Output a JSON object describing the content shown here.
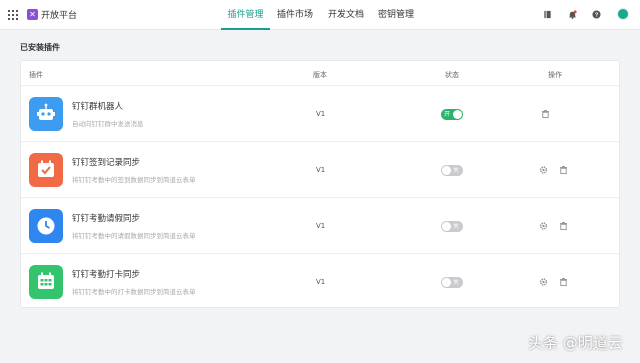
{
  "header": {
    "title": "开放平台",
    "nav": [
      {
        "label": "插件管理",
        "active": true
      },
      {
        "label": "插件市场",
        "active": false
      },
      {
        "label": "开发文档",
        "active": false
      },
      {
        "label": "密钥管理",
        "active": false
      }
    ],
    "icons": [
      "book-icon",
      "bell-icon",
      "help-icon",
      "avatar"
    ]
  },
  "section": {
    "title": "已安装插件"
  },
  "table": {
    "columns": {
      "plugin": "插件",
      "version": "版本",
      "status": "状态",
      "action": "操作"
    },
    "rows": [
      {
        "name": "钉钉群机器人",
        "desc": "自动向钉钉群中发送消息",
        "version": "V1",
        "status": "开",
        "enabled": true,
        "icon": "robot-icon",
        "color": "#3d9bf0",
        "actions": [
          "delete"
        ]
      },
      {
        "name": "钉钉签到记录同步",
        "desc": "将钉钉考勤中的签到数据同步到简道云表单",
        "version": "V1",
        "status": "关",
        "enabled": false,
        "icon": "calendar-check-icon",
        "color": "#f06a45",
        "actions": [
          "settings",
          "delete"
        ]
      },
      {
        "name": "钉钉考勤请假同步",
        "desc": "将钉钉考勤中的请假数据同步到简道云表单",
        "version": "V1",
        "status": "关",
        "enabled": false,
        "icon": "clock-icon",
        "color": "#2f86ee",
        "actions": [
          "settings",
          "delete"
        ]
      },
      {
        "name": "钉钉考勤打卡同步",
        "desc": "将钉钉考勤中的打卡数据同步到简道云表单",
        "version": "V1",
        "status": "关",
        "enabled": false,
        "icon": "calendar-grid-icon",
        "color": "#34c46e",
        "actions": [
          "settings",
          "delete"
        ]
      }
    ]
  },
  "watermark": "头条 @明道云",
  "colors": {
    "accent": "#1a9e8e",
    "toggle_on": "#2bb36b",
    "toggle_off": "#c8cacd"
  }
}
